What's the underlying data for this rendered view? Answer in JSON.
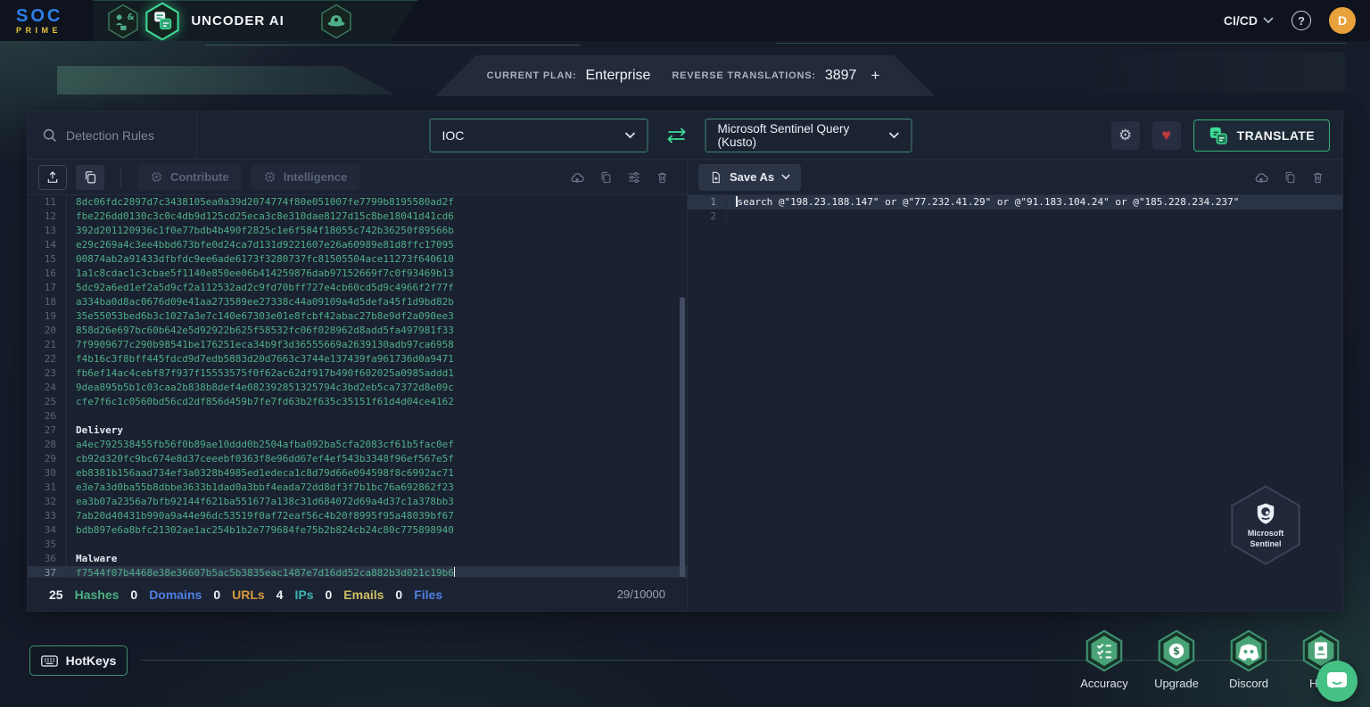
{
  "header": {
    "logo_line1": "SOC",
    "logo_line2": "PRIME",
    "app_title": "UNCODER AI",
    "cicd_label": "CI/CD",
    "avatar_initial": "D"
  },
  "icons": {
    "gear": "⚙",
    "heart": "♥",
    "question": "?",
    "plus": "+"
  },
  "plan_bar": {
    "current_plan_label": "CURRENT PLAN:",
    "current_plan_value": "Enterprise",
    "reverse_translations_label": "REVERSE TRANSLATIONS:",
    "reverse_translations_value": "3897"
  },
  "toolbar": {
    "search_placeholder": "Detection Rules",
    "source_select_value": "IOC",
    "target_select_value": "Microsoft Sentinel Query (Kusto)",
    "translate_label": "TRANSLATE",
    "contribute_label": "Contribute",
    "intelligence_label": "Intelligence",
    "save_as_label": "Save As"
  },
  "left_editor": {
    "lines": [
      {
        "n": 11,
        "k": "hash",
        "t": "8dc06fdc2897d7c3438105ea0a39d2074774f80e051007fe7799b8195580ad2f"
      },
      {
        "n": 12,
        "k": "hash",
        "t": "fbe226dd0130c3c0c4db9d125cd25eca3c8e310dae8127d15c8be18041d41cd6"
      },
      {
        "n": 13,
        "k": "hash",
        "t": "392d201120936c1f0e77bdb4b490f2825c1e6f584f18055c742b36250f89566b"
      },
      {
        "n": 14,
        "k": "hash",
        "t": "e29c269a4c3ee4bbd673bfe0d24ca7d131d9221607e26a60989e81d8ffc17095"
      },
      {
        "n": 15,
        "k": "hash",
        "t": "00874ab2a91433dfbfdc9ee6ade6173f3280737fc81505504ace11273f640610"
      },
      {
        "n": 16,
        "k": "hash",
        "t": "1a1c8cdac1c3cbae5f1140e850ee06b414259876dab97152669f7c0f93469b13"
      },
      {
        "n": 17,
        "k": "hash",
        "t": "5dc92a6ed1ef2a5d9cf2a112532ad2c9fd70bff727e4cb60cd5d9c4966f2f77f"
      },
      {
        "n": 18,
        "k": "hash",
        "t": "a334ba0d8ac0676d09e41aa273589ee27338c44a09109a4d5defa45f1d9bd82b"
      },
      {
        "n": 19,
        "k": "hash",
        "t": "35e55053bed6b3c1027a3e7c140e67303e01e8fcbf42abac27b8e9df2a090ee3"
      },
      {
        "n": 20,
        "k": "hash",
        "t": "858d26e697bc60b642e5d92922b625f58532fc06f028962d8add5fa497981f33"
      },
      {
        "n": 21,
        "k": "hash",
        "t": "7f9909677c290b98541be176251eca34b9f3d36555669a2639130adb97ca6958"
      },
      {
        "n": 22,
        "k": "hash",
        "t": "f4b16c3f8bff445fdcd9d7edb5883d20d7663c3744e137439fa961736d0a9471"
      },
      {
        "n": 23,
        "k": "hash",
        "t": "fb6ef14ac4cebf87f937f15553575f0f62ac62df917b490f602025a0985addd1"
      },
      {
        "n": 24,
        "k": "hash",
        "t": "9dea895b5b1c03caa2b838b8def4e082392851325794c3bd2eb5ca7372d8e09c"
      },
      {
        "n": 25,
        "k": "hash",
        "t": "cfe7f6c1c0560bd56cd2df856d459b7fe7fd63b2f635c35151f61d4d04ce4162"
      },
      {
        "n": 26,
        "k": "empty",
        "t": ""
      },
      {
        "n": 27,
        "k": "label",
        "t": "Delivery"
      },
      {
        "n": 28,
        "k": "hash",
        "t": "a4ec792538455fb56f0b89ae10ddd0b2504afba092ba5cfa2083cf61b5fac0ef"
      },
      {
        "n": 29,
        "k": "hash",
        "t": "cb92d320fc9bc674e8d37ceeebf0363f8e96dd67ef4ef543b3348f96ef567e5f"
      },
      {
        "n": 30,
        "k": "hash",
        "t": "eb8381b156aad734ef3a0328b4985ed1edeca1c8d79d66e094598f8c6992ac71"
      },
      {
        "n": 31,
        "k": "hash",
        "t": "e3e7a3d0ba55b8dbbe3633b1dad0a3bbf4eada72dd8df3f7b1bc76a692862f23"
      },
      {
        "n": 32,
        "k": "hash",
        "t": "ea3b07a2356a7bfb92144f621ba551677a138c31d684072d69a4d37c1a378bb3"
      },
      {
        "n": 33,
        "k": "hash",
        "t": "7ab20d40431b990a9a44e96dc53519f0af72eaf56c4b20f8995f95a48039bf67"
      },
      {
        "n": 34,
        "k": "hash",
        "t": "bdb897e6a8bfc21302ae1ac254b1b2e779684fe75b2b824cb24c80c775898940"
      },
      {
        "n": 35,
        "k": "empty",
        "t": ""
      },
      {
        "n": 36,
        "k": "label",
        "t": "Malware"
      },
      {
        "n": 37,
        "k": "hash",
        "t": "f7544f07b4468e38e36607b5ac5b3835eac1487e7d16dd52ca882b3d021c19b6",
        "active": true,
        "cur": "end"
      }
    ]
  },
  "right_editor": {
    "lines": [
      {
        "n": 1,
        "k": "plain",
        "t": "search @\"198.23.188.147\" or @\"77.232.41.29\" or @\"91.183.104.24\" or @\"185.228.234.237\"",
        "active": true,
        "cur": "start"
      },
      {
        "n": 2,
        "k": "empty",
        "t": ""
      }
    ]
  },
  "status_bar": {
    "counts": [
      {
        "value": "25",
        "label": "Hashes",
        "color": "#4caf82"
      },
      {
        "value": "0",
        "label": "Domains",
        "color": "#4f7fe0"
      },
      {
        "value": "0",
        "label": "URLs",
        "color": "#d79a3c"
      },
      {
        "value": "4",
        "label": "IPs",
        "color": "#3ab5b0"
      },
      {
        "value": "0",
        "label": "Emails",
        "color": "#cfc064"
      },
      {
        "value": "0",
        "label": "Files",
        "color": "#4f7fe0"
      }
    ],
    "limit": "29/10000"
  },
  "watermark": {
    "line1": "Microsoft",
    "line2": "Sentinel"
  },
  "footer": {
    "hotkeys_label": "HotKeys",
    "badges": [
      {
        "label": "Accuracy"
      },
      {
        "label": "Upgrade"
      },
      {
        "label": "Discord"
      },
      {
        "label": "How"
      }
    ]
  },
  "colors": {
    "accent_green": "#3ddc97",
    "select_border": "#3e8a70",
    "hash_text": "#4fae8a",
    "avatar_orange": "#e9a13b",
    "heart_red": "#c23b3b",
    "chat_green": "#46c186"
  }
}
